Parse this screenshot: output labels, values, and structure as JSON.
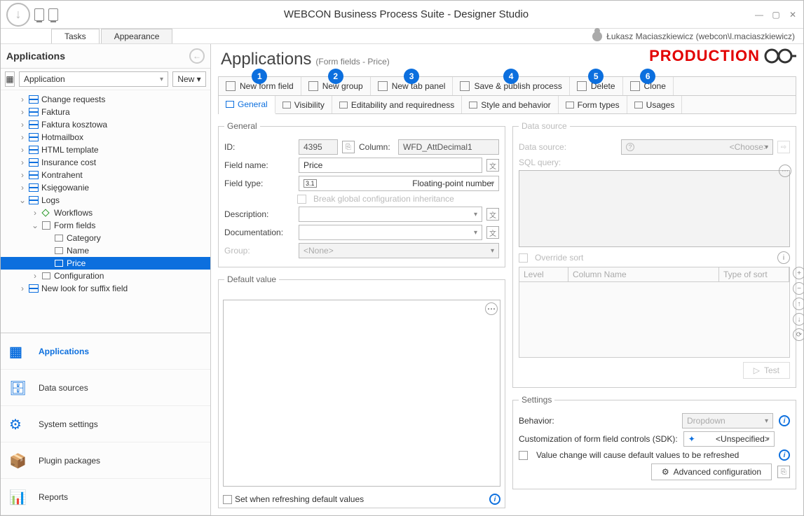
{
  "window": {
    "title": "WEBCON Business Process Suite - Designer Studio"
  },
  "ribbon": {
    "tabs": [
      "Tasks",
      "Appearance"
    ],
    "active": 0
  },
  "user": {
    "display": "Łukasz Maciaszkiewicz (webcon\\l.maciaszkiewicz)"
  },
  "sidebar": {
    "header": "Applications",
    "selector": "Application",
    "new_label": "New",
    "tree": [
      {
        "label": "Change requests",
        "indent": 0,
        "icon": "process",
        "chev": "›"
      },
      {
        "label": "Faktura",
        "indent": 0,
        "icon": "process",
        "chev": "›"
      },
      {
        "label": "Faktura kosztowa",
        "indent": 0,
        "icon": "process",
        "chev": "›"
      },
      {
        "label": "Hotmailbox",
        "indent": 0,
        "icon": "process",
        "chev": "›"
      },
      {
        "label": "HTML template",
        "indent": 0,
        "icon": "process",
        "chev": "›"
      },
      {
        "label": "Insurance cost",
        "indent": 0,
        "icon": "process",
        "chev": "›"
      },
      {
        "label": "Kontrahent",
        "indent": 0,
        "icon": "process",
        "chev": "›"
      },
      {
        "label": "Księgowanie",
        "indent": 0,
        "icon": "process",
        "chev": "›"
      },
      {
        "label": "Logs",
        "indent": 0,
        "icon": "process",
        "chev": "⌄"
      },
      {
        "label": "Workflows",
        "indent": 1,
        "icon": "wf",
        "chev": "›"
      },
      {
        "label": "Form fields",
        "indent": 1,
        "icon": "ff",
        "chev": "⌄"
      },
      {
        "label": "Category",
        "indent": 2,
        "icon": "cat",
        "chev": ""
      },
      {
        "label": "Name",
        "indent": 2,
        "icon": "leaf",
        "chev": ""
      },
      {
        "label": "Price",
        "indent": 2,
        "icon": "leaf",
        "chev": "",
        "selected": true
      },
      {
        "label": "Configuration",
        "indent": 1,
        "icon": "leaf",
        "chev": "›"
      },
      {
        "label": "New look for suffix field",
        "indent": 0,
        "icon": "process",
        "chev": "›"
      }
    ],
    "nav": [
      {
        "label": "Applications",
        "active": true
      },
      {
        "label": "Data sources"
      },
      {
        "label": "System settings"
      },
      {
        "label": "Plugin packages"
      },
      {
        "label": "Reports"
      }
    ]
  },
  "page": {
    "title": "Applications",
    "breadcrumb": "(Form fields - Price)",
    "env": "PRODUCTION"
  },
  "toolbar": [
    {
      "label": "New form field",
      "num": "1"
    },
    {
      "label": "New group",
      "num": "2"
    },
    {
      "label": "New tab panel",
      "num": "3"
    },
    {
      "label": "Save & publish process",
      "num": "4"
    },
    {
      "label": "Delete",
      "num": "5"
    },
    {
      "label": "Clone",
      "num": "6"
    }
  ],
  "tabs": [
    "General",
    "Visibility",
    "Editability and requiredness",
    "Style and behavior",
    "Form types",
    "Usages"
  ],
  "tabs_active": 0,
  "general": {
    "legend": "General",
    "id_label": "ID:",
    "id_value": "4395",
    "column_label": "Column:",
    "column_value": "WFD_AttDecimal1",
    "name_label": "Field name:",
    "name_value": "Price",
    "type_label": "Field type:",
    "type_value": "Floating-point number",
    "type_prefix": "3.1",
    "break_inherit": "Break global configuration inheritance",
    "desc_label": "Description:",
    "desc_value": "",
    "doc_label": "Documentation:",
    "doc_value": "",
    "group_label": "Group:",
    "group_value": "<None>"
  },
  "defval": {
    "legend": "Default value",
    "set_refresh": "Set when refreshing default values"
  },
  "datasource": {
    "legend": "Data source",
    "ds_label": "Data source:",
    "ds_value": "<Choose>",
    "sql_label": "SQL query:",
    "override": "Override sort",
    "cols": [
      "Level",
      "Column Name",
      "Type of sort"
    ],
    "test": "Test"
  },
  "settings": {
    "legend": "Settings",
    "behavior_label": "Behavior:",
    "behavior_value": "Dropdown",
    "sdk_label": "Customization of form field controls (SDK):",
    "sdk_value": "<Unspecified>",
    "refresh_chk": "Value change will cause default values to be refreshed",
    "adv": "Advanced configuration"
  }
}
